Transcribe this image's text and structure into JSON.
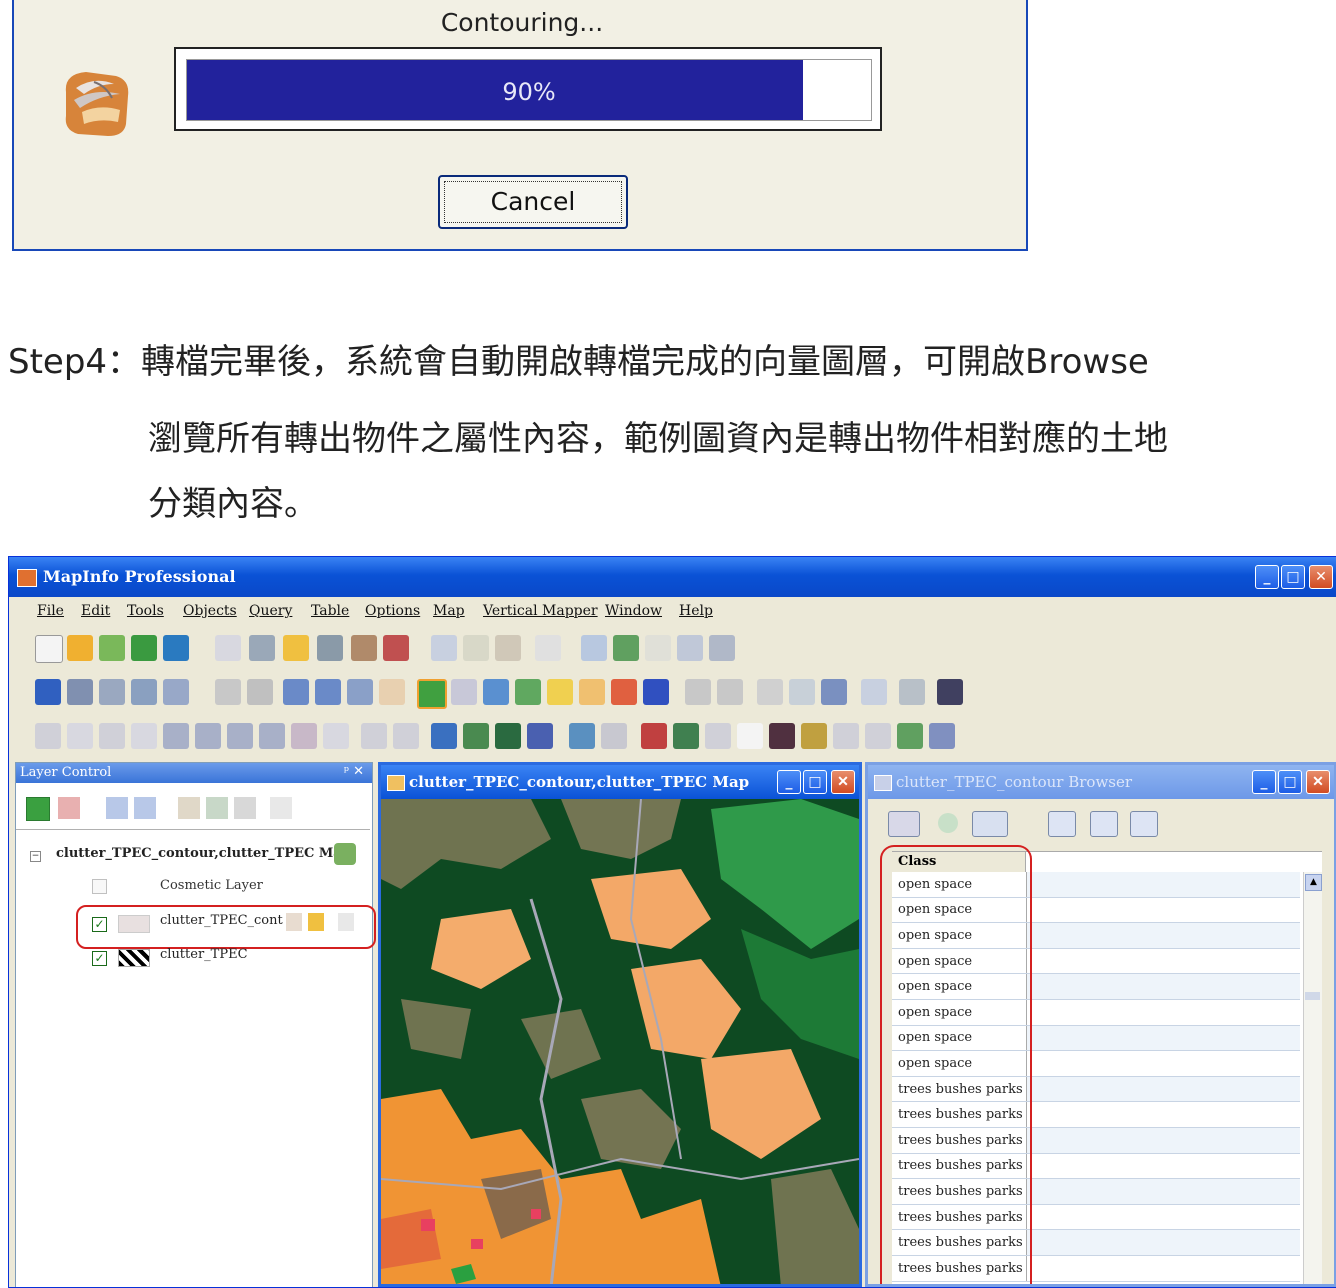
{
  "progress_dialog": {
    "message": "Contouring...",
    "percent_label": "90%",
    "progress": 0.9,
    "cancel_label": "Cancel"
  },
  "text": {
    "line1": "Step4：轉檔完畢後，系統會自動開啟轉檔完成的向量圖層，可開啟Browse",
    "line2": "瀏覽所有轉出物件之屬性內容，範例圖資內是轉出物件相對應的土地",
    "line3": "分類內容。"
  },
  "app": {
    "title": "MapInfo Professional",
    "menu": [
      "File",
      "Edit",
      "Tools",
      "Objects",
      "Query",
      "Table",
      "Options",
      "Map",
      "Vertical Mapper",
      "Window",
      "Help"
    ],
    "window_buttons": {
      "minimize": "_",
      "maximize": "□",
      "close": "✕"
    }
  },
  "layer_control": {
    "title": "Layer Control",
    "pin": "ᵖ ✕",
    "map_node": "clutter_TPEC_contour,clutter_TPEC Ma",
    "layers": [
      {
        "name": "Cosmetic Layer",
        "checked": false
      },
      {
        "name": "clutter_TPEC_cont",
        "checked": true
      },
      {
        "name": "clutter_TPEC",
        "checked": true
      }
    ]
  },
  "map_window": {
    "title": "clutter_TPEC_contour,clutter_TPEC Map"
  },
  "browser": {
    "title": "clutter_TPEC_contour Browser",
    "column": "Class",
    "rows": [
      "open space",
      "open space",
      "open space",
      "open space",
      "open space",
      "open space",
      "open space",
      "open space",
      "trees bushes parks",
      "trees bushes parks",
      "trees bushes parks",
      "trees bushes parks",
      "trees bushes parks",
      "trees bushes parks",
      "trees bushes parks",
      "trees bushes parks"
    ]
  },
  "colors": {
    "progress_fill": "#22229c",
    "highlight": "#d42020",
    "titlebar": "#0a52d6"
  }
}
